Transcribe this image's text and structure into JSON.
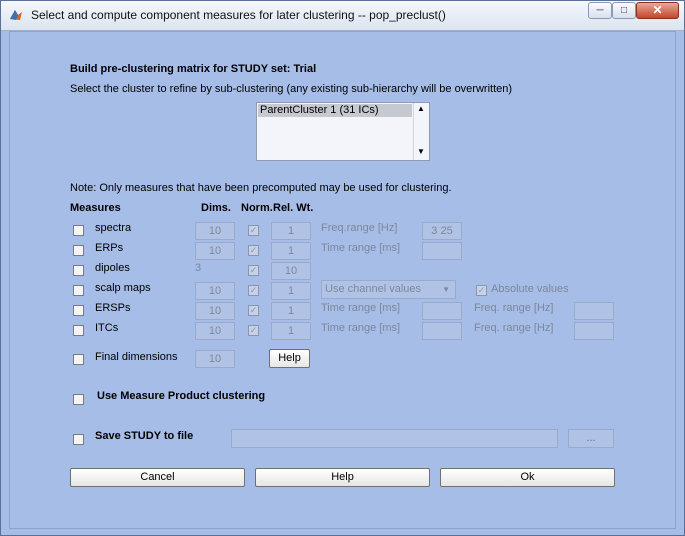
{
  "window": {
    "title": "Select and compute component measures for later clustering -- pop_preclust()"
  },
  "header": {
    "heading": "Build pre-clustering matrix for STUDY set:  Trial",
    "subtitle": "Select the cluster to refine by sub-clustering (any existing sub-hierarchy will be overwritten)"
  },
  "cluster_list": {
    "items": [
      "ParentCluster 1 (31 ICs)"
    ]
  },
  "note": "Note: Only measures that have been precomputed may be used for clustering.",
  "columns": {
    "measures": "Measures",
    "dims": "Dims.",
    "norm": "Norm.",
    "relwt": "Rel. Wt."
  },
  "rows": {
    "spectra": {
      "label": "spectra",
      "dims": "10",
      "relwt": "1",
      "range_label": "Freq.range [Hz]",
      "range_value": "3  25"
    },
    "erps": {
      "label": "ERPs",
      "dims": "10",
      "relwt": "1",
      "range_label": "Time range [ms]"
    },
    "dipoles": {
      "label": "dipoles",
      "dims": "3",
      "relwt": "10"
    },
    "scalp": {
      "label": "scalp maps",
      "dims": "10",
      "relwt": "1",
      "select": "Use channel values",
      "abs_label": "Absolute values"
    },
    "ersps": {
      "label": "ERSPs",
      "dims": "10",
      "relwt": "1",
      "time_label": "Time range [ms]",
      "freq_label": "Freq. range [Hz]"
    },
    "itcs": {
      "label": "ITCs",
      "dims": "10",
      "relwt": "1",
      "time_label": "Time range [ms]",
      "freq_label": "Freq. range [Hz]"
    }
  },
  "final_dims": {
    "label": "Final dimensions",
    "value": "10",
    "help": "Help"
  },
  "product": {
    "label": "Use Measure Product clustering"
  },
  "save": {
    "label": "Save STUDY to file",
    "browse": "..."
  },
  "buttons": {
    "cancel": "Cancel",
    "help": "Help",
    "ok": "Ok"
  }
}
